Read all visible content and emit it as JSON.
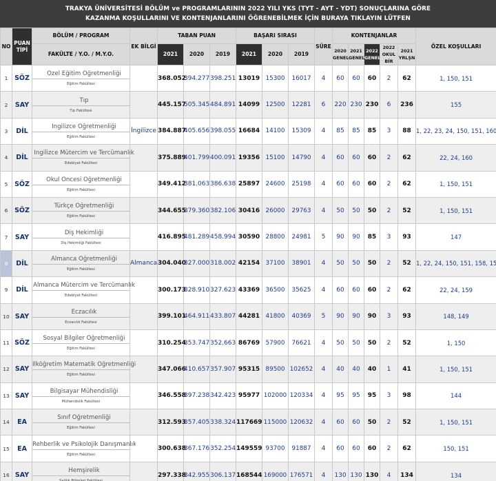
{
  "title": {
    "line1": "TRAKYA ÜNİVERSİTESİ BÖLÜM ve PROGRAMLARININ 2022 YILI YKS (TYT - AYT - YDT) SONUÇLARINA GÖRE",
    "line2": "KAZANMA KOŞULLARINI VE KONTENJANLARINI ÖĞRENEBİLMEK İÇİN BURAYA TIKLAYIN LÜTFEN"
  },
  "headers": {
    "no": "NO",
    "puan_tipi": "PUAN TİPİ",
    "bolum": "BÖLÜM / PROGRAM",
    "fakulte": "FAKÜLTE / Y.O. / M.Y.O.",
    "ek_bilgi": "EK BİLGİ",
    "taban_puan": "TABAN PUAN",
    "basari_sirasi": "BAŞARI SIRASI",
    "sure": "SÜRE",
    "kontenjanlar": "KONTENJANLAR",
    "ozel": "ÖZEL KOŞULLARI",
    "y2021": "2021",
    "y2020": "2020",
    "y2019": "2019",
    "k2020": "2020 GENEL",
    "k2021": "2021 GENEL",
    "k2022": "2022 GENEL",
    "k2022okul": "2022 OKUL BİR",
    "k2021yer": "2021 YRLŞN"
  },
  "rows": [
    {
      "no": "1",
      "pt": "SÖZ",
      "program": "Özel Eğitim Öğretmenliği",
      "faculty": "Eğitim Fakültesi",
      "ek": "",
      "tp21": "368.052",
      "tp20": "394.277",
      "tp19": "398.251",
      "bs21": "13019",
      "bs20": "15300",
      "bs19": "16017",
      "sure": "4",
      "k20": "60",
      "k21": "60",
      "k22": "60",
      "k22o": "2",
      "k21y": "62",
      "oz": "1, 150, 151"
    },
    {
      "no": "2",
      "pt": "SAY",
      "program": "Tıp",
      "faculty": "Tıp Fakültesi",
      "ek": "",
      "tp21": "445.157",
      "tp20": "505.345",
      "tp19": "484.891",
      "bs21": "14099",
      "bs20": "12500",
      "bs19": "12281",
      "sure": "6",
      "k20": "220",
      "k21": "230",
      "k22": "230",
      "k22o": "6",
      "k21y": "236",
      "oz": "155"
    },
    {
      "no": "3",
      "pt": "DİL",
      "program": "İngilizce Öğretmenliği",
      "faculty": "Eğitim Fakültesi",
      "ek": "İngilizce",
      "tp21": "384.887",
      "tp20": "405.656",
      "tp19": "398.055",
      "bs21": "16684",
      "bs20": "14100",
      "bs19": "15309",
      "sure": "4",
      "k20": "85",
      "k21": "85",
      "k22": "85",
      "k22o": "3",
      "k21y": "88",
      "oz": "1, 22, 23, 24, 150, 151, 160"
    },
    {
      "no": "4",
      "pt": "DİL",
      "program": "İngilizce Mütercim ve Tercümanlık",
      "faculty": "Edebiyat Fakültesi",
      "ek": "",
      "tp21": "375.889",
      "tp20": "401.799",
      "tp19": "400.091",
      "bs21": "19356",
      "bs20": "15100",
      "bs19": "14790",
      "sure": "4",
      "k20": "60",
      "k21": "60",
      "k22": "60",
      "k22o": "2",
      "k21y": "62",
      "oz": "22, 24, 160"
    },
    {
      "no": "5",
      "pt": "SÖZ",
      "program": "Okul Öncesi Öğretmenliği",
      "faculty": "Eğitim Fakültesi",
      "ek": "",
      "tp21": "349.412",
      "tp20": "381.063",
      "tp19": "386.638",
      "bs21": "25897",
      "bs20": "24600",
      "bs19": "25198",
      "sure": "4",
      "k20": "60",
      "k21": "60",
      "k22": "60",
      "k22o": "2",
      "k21y": "62",
      "oz": "1, 150, 151"
    },
    {
      "no": "6",
      "pt": "SÖZ",
      "program": "Türkçe Öğretmenliği",
      "faculty": "Eğitim Fakültesi",
      "ek": "",
      "tp21": "344.655",
      "tp20": "379.360",
      "tp19": "382.106",
      "bs21": "30416",
      "bs20": "26000",
      "bs19": "29763",
      "sure": "4",
      "k20": "50",
      "k21": "50",
      "k22": "50",
      "k22o": "2",
      "k21y": "52",
      "oz": "1, 150, 151"
    },
    {
      "no": "7",
      "pt": "SAY",
      "program": "Diş Hekimliği",
      "faculty": "Diş Hekimliği Fakültesi",
      "ek": "",
      "tp21": "416.895",
      "tp20": "481.289",
      "tp19": "458.994",
      "bs21": "30590",
      "bs20": "28800",
      "bs19": "24981",
      "sure": "5",
      "k20": "90",
      "k21": "90",
      "k22": "85",
      "k22o": "3",
      "k21y": "93",
      "oz": "147"
    },
    {
      "no": "8",
      "pt": "DİL",
      "program": "Almanca Öğretmenliği",
      "faculty": "Eğitim Fakültesi",
      "ek": "Almanca",
      "tp21": "304.040",
      "tp20": "327.000",
      "tp19": "318.002",
      "bs21": "42154",
      "bs20": "37100",
      "bs19": "38901",
      "sure": "4",
      "k20": "50",
      "k21": "50",
      "k22": "50",
      "k22o": "2",
      "k21y": "52",
      "oz": "1, 22, 24, 150, 151, 158, 159"
    },
    {
      "no": "9",
      "pt": "DİL",
      "program": "Almanca Mütercim ve Tercümanlık",
      "faculty": "Edebiyat Fakültesi",
      "ek": "",
      "tp21": "300.173",
      "tp20": "328.910",
      "tp19": "327.623",
      "bs21": "43369",
      "bs20": "36500",
      "bs19": "35625",
      "sure": "4",
      "k20": "60",
      "k21": "60",
      "k22": "60",
      "k22o": "2",
      "k21y": "62",
      "oz": "22, 24, 159"
    },
    {
      "no": "10",
      "pt": "SAY",
      "program": "Eczacılık",
      "faculty": "Eczacılık Fakültesi",
      "ek": "",
      "tp21": "399.101",
      "tp20": "464.911",
      "tp19": "433.807",
      "bs21": "44281",
      "bs20": "41800",
      "bs19": "40369",
      "sure": "5",
      "k20": "90",
      "k21": "90",
      "k22": "90",
      "k22o": "3",
      "k21y": "93",
      "oz": "148, 149"
    },
    {
      "no": "11",
      "pt": "SÖZ",
      "program": "Sosyal Bilgiler Öğretmenliği",
      "faculty": "Eğitim Fakültesi",
      "ek": "",
      "tp21": "310.254",
      "tp20": "353.747",
      "tp19": "352.663",
      "bs21": "86769",
      "bs20": "57900",
      "bs19": "76621",
      "sure": "4",
      "k20": "50",
      "k21": "50",
      "k22": "50",
      "k22o": "2",
      "k21y": "52",
      "oz": "1, 150"
    },
    {
      "no": "12",
      "pt": "SAY",
      "program": "İlköğretim Matematik Öğretmenliği",
      "faculty": "Eğitim Fakültesi",
      "ek": "",
      "tp21": "347.066",
      "tp20": "410.657",
      "tp19": "357.907",
      "bs21": "95315",
      "bs20": "89500",
      "bs19": "102652",
      "sure": "4",
      "k20": "40",
      "k21": "40",
      "k22": "40",
      "k22o": "1",
      "k21y": "41",
      "oz": "1, 150, 151"
    },
    {
      "no": "13",
      "pt": "SAY",
      "program": "Bilgisayar Mühendisliği",
      "faculty": "Mühendislik Fakültesi",
      "ek": "",
      "tp21": "346.558",
      "tp20": "397.238",
      "tp19": "342.423",
      "bs21": "95977",
      "bs20": "102000",
      "bs19": "120334",
      "sure": "4",
      "k20": "95",
      "k21": "95",
      "k22": "95",
      "k22o": "3",
      "k21y": "98",
      "oz": "144"
    },
    {
      "no": "14",
      "pt": "EA",
      "program": "Sınıf Öğretmenliği",
      "faculty": "Eğitim Fakültesi",
      "ek": "",
      "tp21": "312.593",
      "tp20": "357.405",
      "tp19": "338.324",
      "bs21": "117669",
      "bs20": "115000",
      "bs19": "120632",
      "sure": "4",
      "k20": "60",
      "k21": "60",
      "k22": "50",
      "k22o": "2",
      "k21y": "52",
      "oz": "1, 150, 151"
    },
    {
      "no": "15",
      "pt": "EA",
      "program": "Rehberlik ve Psikolojik Danışmanlık",
      "faculty": "Eğitim Fakültesi",
      "ek": "",
      "tp21": "300.638",
      "tp20": "367.176",
      "tp19": "352.254",
      "bs21": "149559",
      "bs20": "93700",
      "bs19": "91887",
      "sure": "4",
      "k20": "60",
      "k21": "60",
      "k22": "60",
      "k22o": "2",
      "k21y": "62",
      "oz": "150, 151"
    },
    {
      "no": "16",
      "pt": "SAY",
      "program": "Hemşirelik",
      "faculty": "Sağlık Bilimleri Fakültesi",
      "ek": "",
      "tp21": "297.338",
      "tp20": "342.955",
      "tp19": "306.137",
      "bs21": "168544",
      "bs20": "169000",
      "bs19": "176571",
      "sure": "4",
      "k20": "130",
      "k21": "130",
      "k22": "130",
      "k22o": "4",
      "k21y": "134",
      "oz": "134"
    }
  ]
}
